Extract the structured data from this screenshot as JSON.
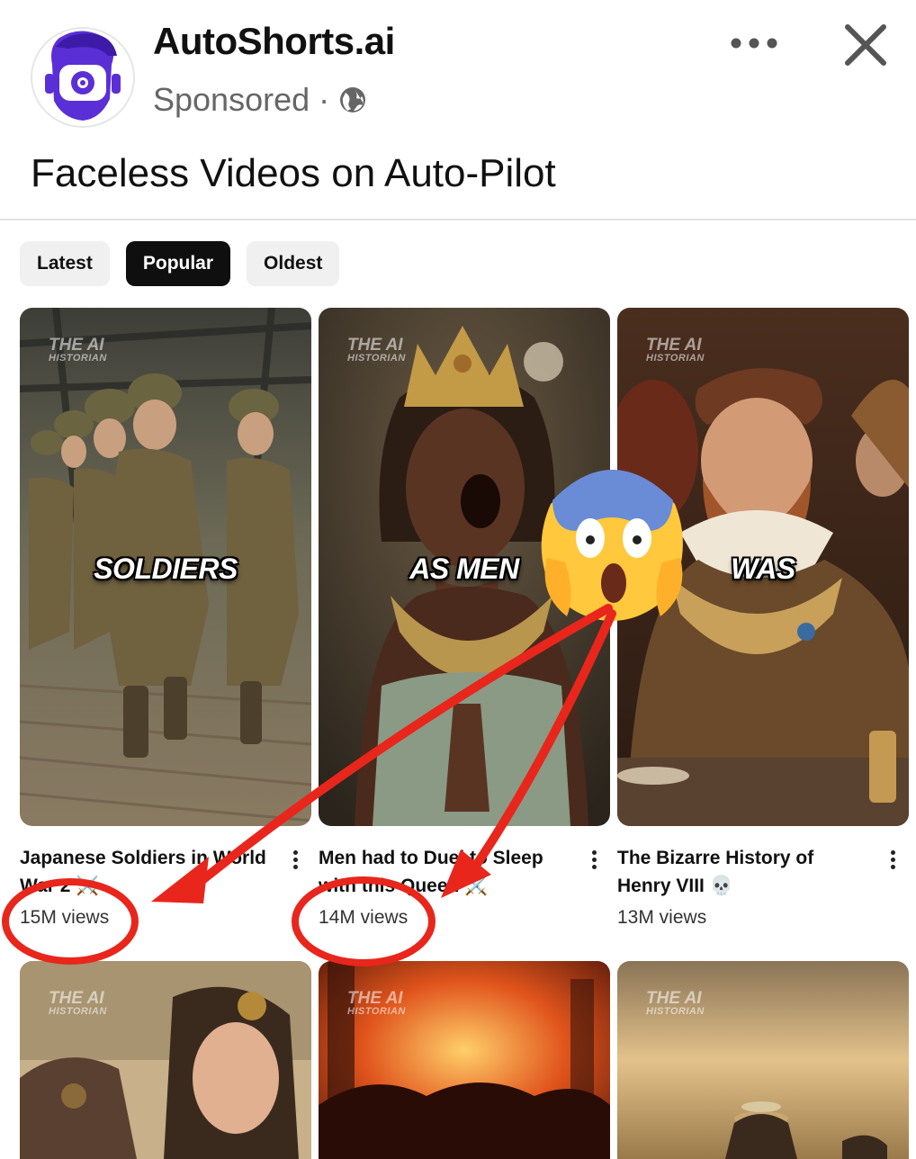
{
  "advertiser": {
    "name": "AutoShorts.ai",
    "sponsored_label": "Sponsored",
    "separator": "·"
  },
  "ad": {
    "headline": "Faceless Videos on Auto-Pilot"
  },
  "chips": [
    {
      "label": "Latest",
      "active": false
    },
    {
      "label": "Popular",
      "active": true
    },
    {
      "label": "Oldest",
      "active": false
    }
  ],
  "videos": [
    {
      "title": "Japanese Soldiers in World War 2 ⚔️",
      "views": "15M views",
      "caption": "SOLDIERS",
      "watermark_line1": "THE AI",
      "watermark_line2": "HISTORIAN"
    },
    {
      "title": "Men had to Duel to Sleep with this Queen ⚔️",
      "views": "14M views",
      "caption": "AS MEN",
      "watermark_line1": "THE AI",
      "watermark_line2": "HISTORIAN"
    },
    {
      "title": "The Bizarre History of Henry VIII 💀",
      "views": "13M views",
      "caption": "WAS",
      "watermark_line1": "THE AI",
      "watermark_line2": "HISTORIAN"
    }
  ],
  "videos_row2": [
    {
      "watermark_line1": "THE AI",
      "watermark_line2": "HISTORIAN"
    },
    {
      "watermark_line1": "THE AI",
      "watermark_line2": "HISTORIAN"
    },
    {
      "watermark_line1": "THE AI",
      "watermark_line2": "HISTORIAN"
    }
  ],
  "icons": {
    "avatar": "robot-face-logo",
    "globe": "globe-icon",
    "more": "more-horizontal-icon",
    "close": "close-icon",
    "reaction": "screaming-face-emoji",
    "video_menu": "more-vertical-icon"
  },
  "annotation_color": "#e8261c"
}
